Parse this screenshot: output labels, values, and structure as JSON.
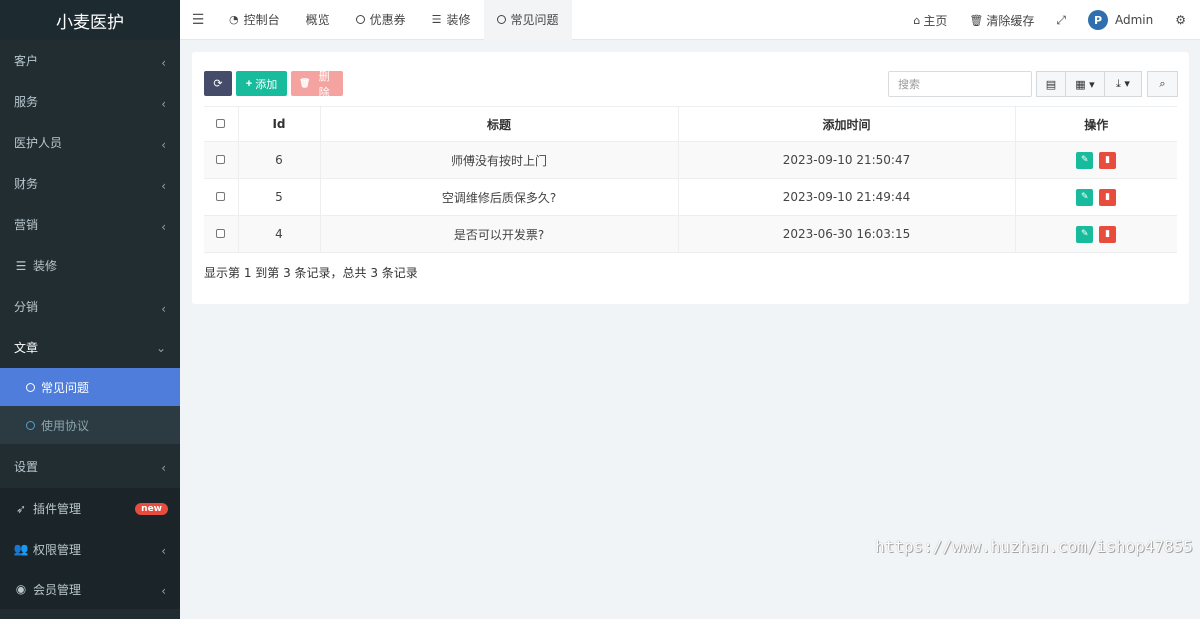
{
  "brand": "小麦医护",
  "sidebar": {
    "items": [
      {
        "label": "客户"
      },
      {
        "label": "服务"
      },
      {
        "label": "医护人员"
      },
      {
        "label": "财务"
      },
      {
        "label": "营销"
      },
      {
        "label": "装修"
      },
      {
        "label": "分销"
      },
      {
        "label": "文章"
      }
    ],
    "sub_items": [
      {
        "label": "常见问题"
      },
      {
        "label": "使用协议"
      }
    ],
    "settings": "设置",
    "lower": [
      {
        "label": "插件管理",
        "badge": "new"
      },
      {
        "label": "权限管理"
      },
      {
        "label": "会员管理"
      }
    ]
  },
  "header": {
    "tabs": [
      {
        "label": "控制台",
        "icon": "dashboard-icon"
      },
      {
        "label": "概览",
        "icon": ""
      },
      {
        "label": "优惠券",
        "icon": "circle-icon"
      },
      {
        "label": "装修",
        "icon": "list-icon"
      },
      {
        "label": "常见问题",
        "icon": "circle-icon"
      }
    ],
    "home": "主页",
    "clear_cache": "清除缓存",
    "user": "Admin"
  },
  "toolbar": {
    "add_label": "添加",
    "delete_label": "删除",
    "search_placeholder": "搜索"
  },
  "table": {
    "columns": [
      "Id",
      "标题",
      "添加时间",
      "操作"
    ],
    "rows": [
      {
        "id": "6",
        "title": "师傅没有按时上门",
        "time": "2023-09-10 21:50:47"
      },
      {
        "id": "5",
        "title": "空调维修后质保多久?",
        "time": "2023-09-10 21:49:44"
      },
      {
        "id": "4",
        "title": "是否可以开发票?",
        "time": "2023-06-30 16:03:15"
      }
    ]
  },
  "pagination_text": "显示第 1 到第 3 条记录，总共 3 条记录",
  "watermark": "https://www.huzhan.com/ishop47855",
  "colors": {
    "sidebar": "#222d32",
    "active": "#4f7ddb",
    "green": "#18bc9c",
    "red": "#e74c3c"
  }
}
